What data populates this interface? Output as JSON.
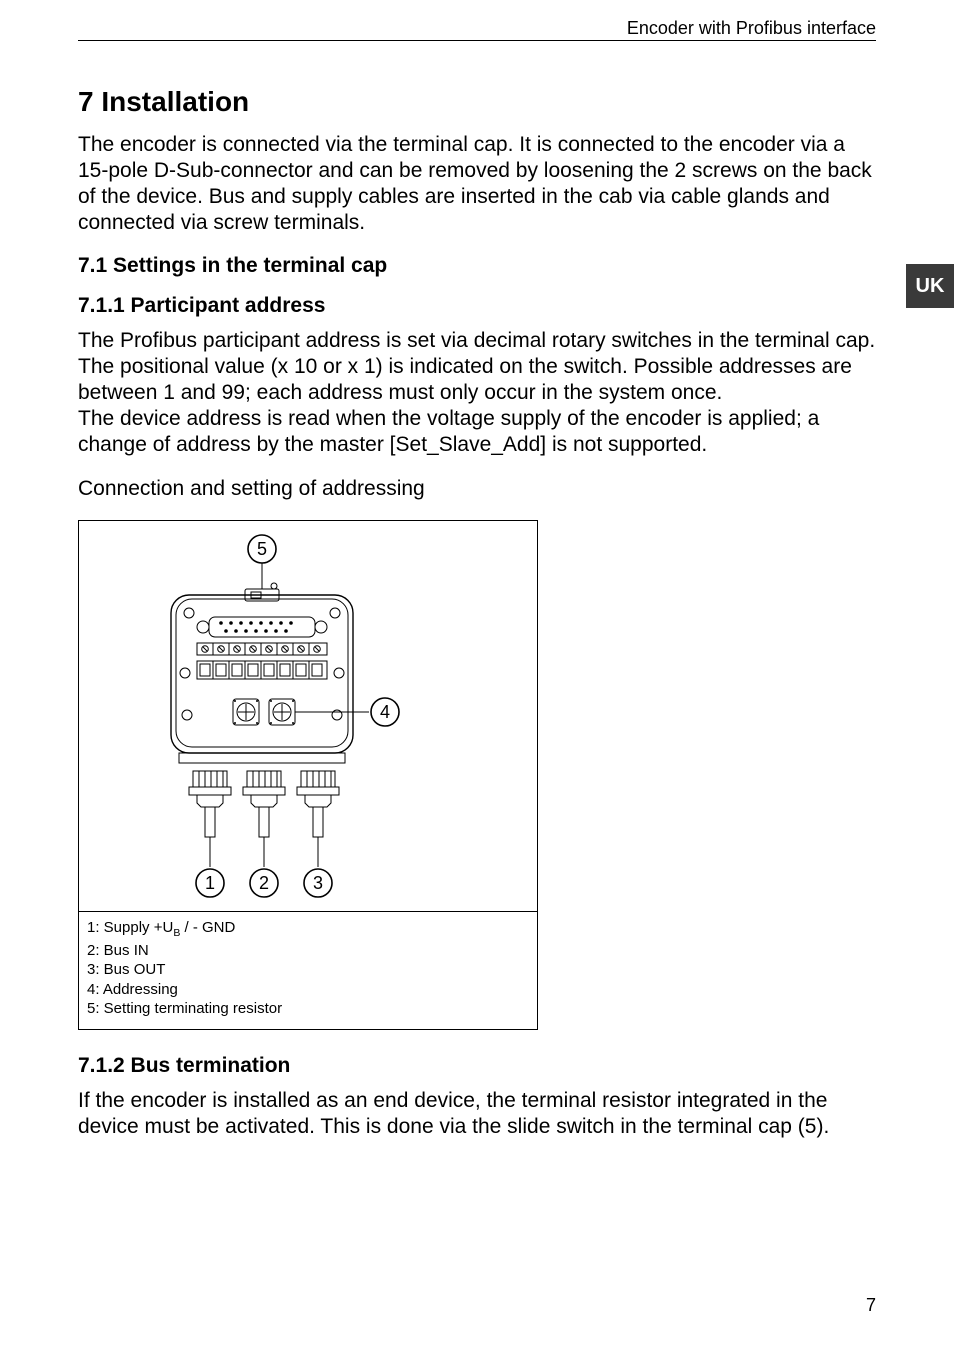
{
  "header": {
    "doc_title": "Encoder with Profibus interface"
  },
  "lang_tab": "UK",
  "h1": "7  Installation",
  "p1": "The encoder is connected via the terminal cap. It is connected to the encoder via a 15-pole D-Sub-connector and can be removed by loosening the 2 screws on the back of the device. Bus and supply cables are inserted in the cab via cable glands and connected via screw terminals.",
  "h2_71": "7.1  Settings in the terminal cap",
  "h3_711": "7.1.1  Participant address",
  "p2": "The Profibus participant address is set via decimal rotary switches in the terminal cap. The positional value (x 10 or x 1) is indicated on the switch. Possible addresses are between 1 and 99; each address must only occur in the system once.",
  "p3": "The device address is read when the voltage supply of the encoder is applied; a change of address by the master [Set_Slave_Add] is not supported.",
  "p4": "Connection and setting of addressing",
  "figure": {
    "labels": {
      "n1": "1",
      "n2": "2",
      "n3": "3",
      "n4": "4",
      "n5": "5"
    },
    "caption_l1a": "1:  Supply +U",
    "caption_l1b": " / - GND",
    "caption_sub": "B",
    "caption_l2": "2:  Bus IN",
    "caption_l3": "3:  Bus OUT",
    "caption_l4": "4:  Addressing",
    "caption_l5": "5:  Setting terminating resistor"
  },
  "h3_712": "7.1.2  Bus termination",
  "p5": "If the encoder is installed as an end device, the terminal resistor integrated in the device must be activated. This is done via the slide switch in the terminal cap (5).",
  "page_number": "7"
}
